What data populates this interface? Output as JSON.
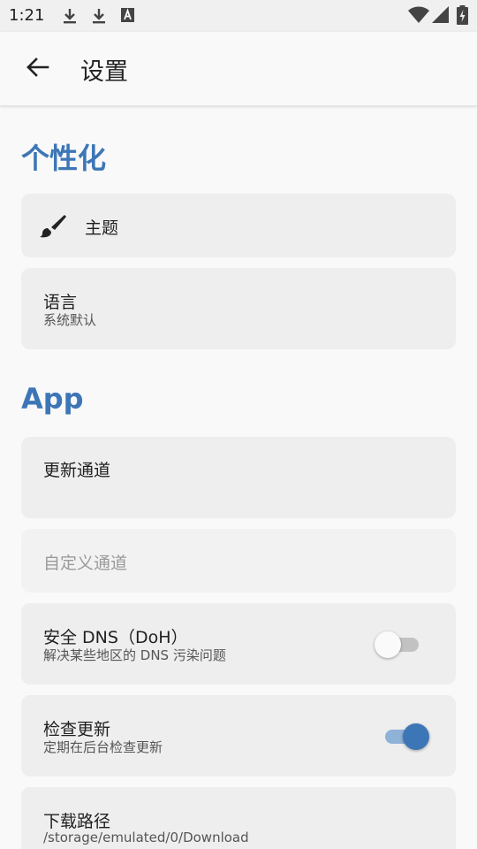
{
  "status_bar": {
    "time": "1:21",
    "icons": [
      "download-icon",
      "download-icon",
      "font-a-icon",
      "wifi-icon",
      "cell-signal-icon",
      "battery-charging-icon"
    ]
  },
  "app_bar": {
    "title": "设置",
    "back_icon": "arrow-left-icon"
  },
  "sections": {
    "personalization": {
      "title": "个性化",
      "theme": {
        "label": "主题",
        "icon": "brush-icon"
      },
      "language": {
        "label": "语言",
        "value": "系统默认"
      }
    },
    "app": {
      "title": "App",
      "update_channel": {
        "label": "更新通道"
      },
      "custom_channel": {
        "label": "自定义通道"
      },
      "secure_dns": {
        "label": "安全 DNS（DoH）",
        "desc": "解决某些地区的 DNS 污染问题",
        "enabled": false
      },
      "check_update": {
        "label": "检查更新",
        "desc": "定期在后台检查更新",
        "enabled": true
      },
      "download_path": {
        "label": "下载路径",
        "value": "/storage/emulated/0/Download"
      }
    }
  },
  "colors": {
    "accent": "#3d76b6",
    "card": "#eeeeee",
    "background": "#f9f9f9"
  }
}
